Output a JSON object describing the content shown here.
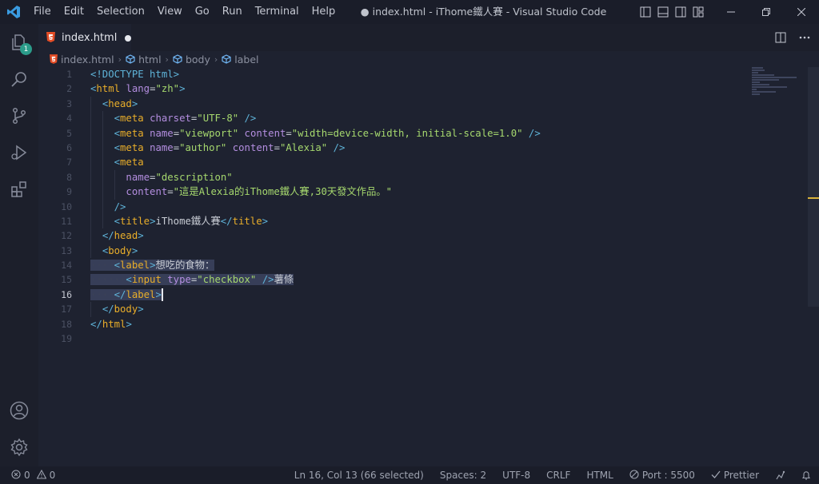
{
  "window": {
    "title": "● index.html - iThome鐵人賽 - Visual Studio Code"
  },
  "menu": [
    "File",
    "Edit",
    "Selection",
    "View",
    "Go",
    "Run",
    "Terminal",
    "Help"
  ],
  "activity_badge": "1",
  "tab": {
    "label": "index.html"
  },
  "breadcrumb": [
    "index.html",
    "html",
    "body",
    "label"
  ],
  "line_numbers": [
    "1",
    "2",
    "3",
    "4",
    "5",
    "6",
    "7",
    "8",
    "9",
    "10",
    "11",
    "12",
    "13",
    "14",
    "15",
    "16",
    "17",
    "18",
    "19"
  ],
  "active_line": 16,
  "code": {
    "l1_doctype": "<!DOCTYPE html>",
    "l2_tag": "html",
    "l2_attr": "lang",
    "l2_val": "\"zh\"",
    "l3_tag": "head",
    "l4_tag": "meta",
    "l4_attr": "charset",
    "l4_val": "\"UTF-8\"",
    "l5_tag": "meta",
    "l5_attr1": "name",
    "l5_val1": "\"viewport\"",
    "l5_attr2": "content",
    "l5_val2": "\"width=device-width, initial-scale=1.0\"",
    "l6_tag": "meta",
    "l6_attr1": "name",
    "l6_val1": "\"author\"",
    "l6_attr2": "content",
    "l6_val2": "\"Alexia\"",
    "l7_tag": "meta",
    "l8_attr": "name",
    "l8_val": "\"description\"",
    "l9_attr": "content",
    "l9_val": "\"這是Alexia的iThome鐵人賽,30天發文作品。\"",
    "l11_tag": "title",
    "l11_text": "iThome鐵人賽",
    "l12_tag": "head",
    "l13_tag": "body",
    "l14_tag": "label",
    "l14_text": "想吃的食物：",
    "l15_tag": "input",
    "l15_attr": "type",
    "l15_val": "\"checkbox\"",
    "l15_text": "薯條",
    "l16_tag": "label",
    "l17_tag": "body",
    "l18_tag": "html"
  },
  "status": {
    "errors": "0",
    "warnings": "0",
    "position": "Ln 16, Col 13 (66 selected)",
    "spaces": "Spaces: 2",
    "encoding": "UTF-8",
    "eol": "CRLF",
    "language": "HTML",
    "port": "Port : 5500",
    "prettier": "Prettier"
  },
  "colors": {
    "background": "#1e2230",
    "tag": "#e9ae2a",
    "attribute": "#b48ee0",
    "string": "#a6d86e",
    "bracket": "#5fb3d8",
    "selection": "#373e58",
    "badge": "#2b9c8a"
  }
}
